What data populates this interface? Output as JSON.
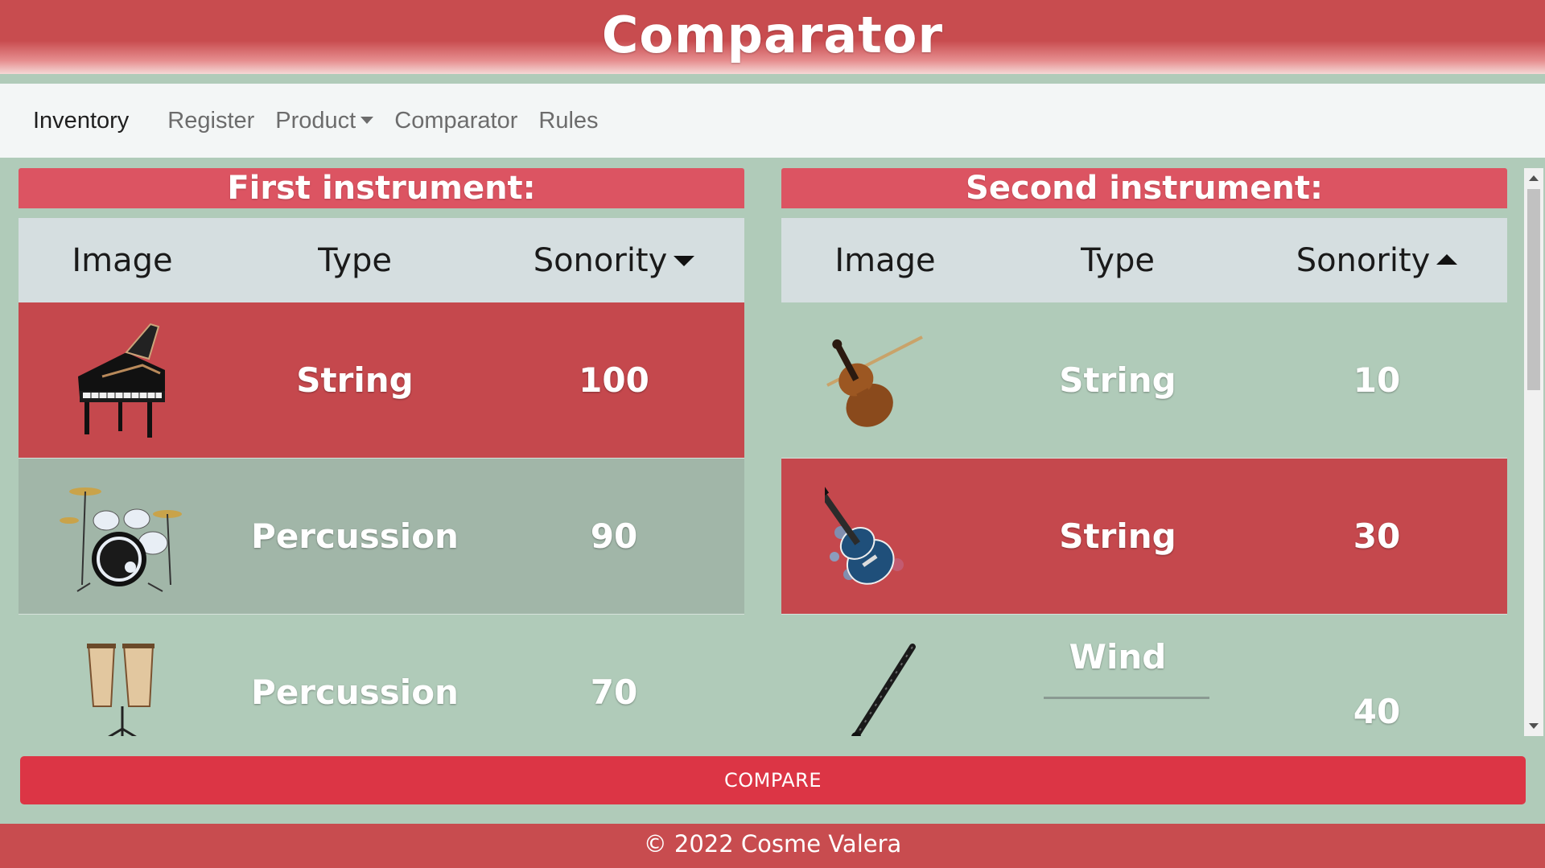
{
  "header": {
    "title": "Comparator"
  },
  "nav": {
    "brand": "Inventory",
    "links": [
      "Register",
      "Product",
      "Comparator",
      "Rules"
    ]
  },
  "panels": [
    {
      "title": "First instrument:",
      "columns": [
        "Image",
        "Type",
        "Sonority"
      ],
      "sort": "descending",
      "rows": [
        {
          "image": "grand-piano",
          "type": "String",
          "sonority": "100",
          "highlight": "red"
        },
        {
          "image": "drum-kit",
          "type": "Percussion",
          "sonority": "90",
          "highlight": "grey"
        },
        {
          "image": "congas",
          "type": "Percussion",
          "sonority": "70",
          "highlight": "none"
        }
      ]
    },
    {
      "title": "Second instrument:",
      "columns": [
        "Image",
        "Type",
        "Sonority"
      ],
      "sort": "ascending",
      "rows": [
        {
          "image": "violin",
          "type": "String",
          "sonority": "10",
          "highlight": "none"
        },
        {
          "image": "electric-guitar",
          "type": "String",
          "sonority": "30",
          "highlight": "red"
        },
        {
          "image": "clarinet",
          "type": "Wind",
          "sonority": "40",
          "highlight": "none"
        }
      ]
    }
  ],
  "compare_button": "COMPARE",
  "footer": "© 2022 Cosme Valera",
  "colors": {
    "accent": "#dc3545",
    "header": "#c84c4f",
    "panel_title": "#dc5462",
    "row_selected": "#c5484d",
    "row_hover": "#a1b6a8",
    "background": "#b0cbb9"
  }
}
